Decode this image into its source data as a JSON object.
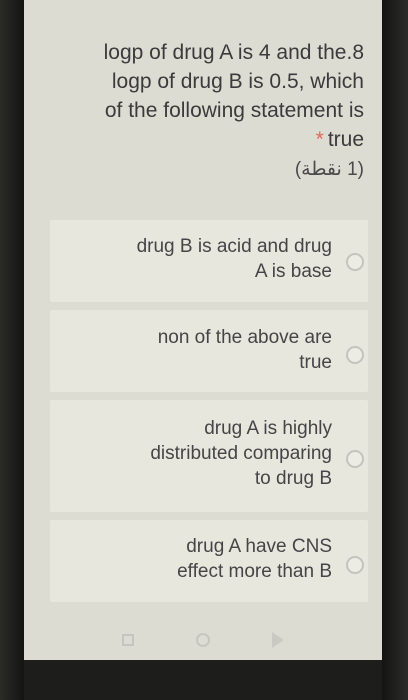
{
  "question": {
    "lines": [
      "logp of drug A is 4 and the.8",
      "logp of drug B is 0.5, which",
      "of the following statement is"
    ],
    "required_marker": "*",
    "required_text": "true",
    "points_label": "(1 نقطة)"
  },
  "options": [
    {
      "lines": [
        "drug B is acid and drug",
        "A is base"
      ],
      "selected": false
    },
    {
      "lines": [
        "non of the above are",
        "true"
      ],
      "selected": false
    },
    {
      "lines": [
        "drug A is highly",
        "distributed comparing",
        "to drug B"
      ],
      "selected": false
    },
    {
      "lines": [
        "drug A have CNS",
        "effect more than B"
      ],
      "selected": false
    }
  ],
  "navbar": {
    "icons": [
      "recents-square-icon",
      "home-circle-icon",
      "back-triangle-icon"
    ]
  }
}
